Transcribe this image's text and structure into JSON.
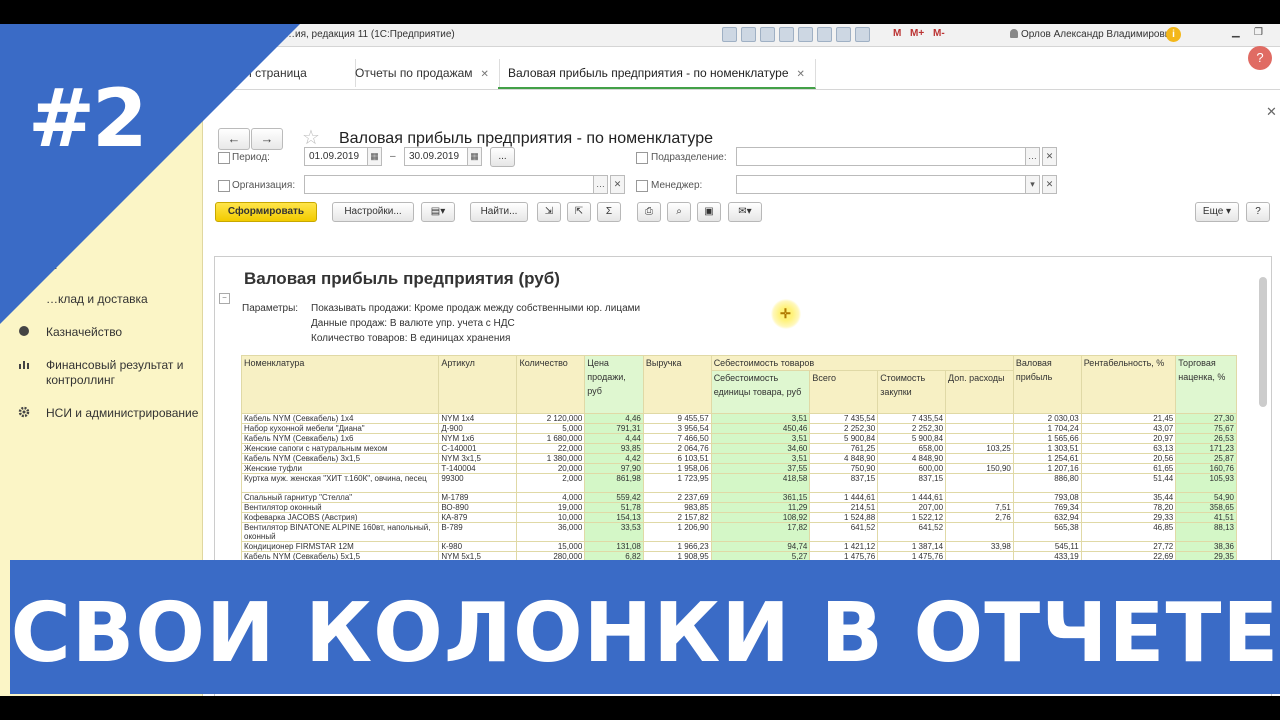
{
  "window": {
    "title": "…ия, редакция 11 (1С:Предприятие)",
    "user": "Орлов Александр Владимирович",
    "mm": [
      "M",
      "M+",
      "M-"
    ]
  },
  "tabs": [
    {
      "label": "…ная страница"
    },
    {
      "label": "Отчеты по продажам"
    },
    {
      "label": "Валовая прибыль предприятия - по номенклатуре"
    }
  ],
  "sidebar": {
    "items": [
      {
        "label": "…"
      },
      {
        "label": "…клад и доставка"
      },
      {
        "label": "Казначейство"
      },
      {
        "label": "Финансовый результат и контроллинг"
      },
      {
        "label": "НСИ и администрирование"
      }
    ]
  },
  "form": {
    "title": "Валовая прибыль предприятия - по номенклатуре",
    "period_label": "Период:",
    "date_from": "01.09.2019",
    "date_to": "30.09.2019",
    "dash": "–",
    "org_label": "Организация:",
    "dept_label": "Подразделение:",
    "manager_label": "Менеджер:",
    "buttons": {
      "generate": "Сформировать",
      "settings": "Настройки...",
      "find": "Найти...",
      "sum": "Σ",
      "more": "Еще ▾",
      "help": "?",
      "dots": "..."
    }
  },
  "report": {
    "title": "Валовая прибыль предприятия (руб)",
    "params_label": "Параметры:",
    "params": [
      "Показывать продажи: Кроме продаж между собственными юр. лицами",
      "Данные продаж: В валюте упр. учета с НДС",
      "Количество товаров: В единицах хранения"
    ],
    "headers": {
      "nomenclature": "Номенклатура",
      "article": "Артикул",
      "qty": "Количество",
      "price": "Цена продажи, руб",
      "revenue": "Выручка",
      "cost_group": "Себестоимость товаров",
      "unit_cost": "Себестоимость единицы товара, руб",
      "total": "Всего",
      "purchase_cost": "Стоимость закупки",
      "extra": "Доп. расходы",
      "gross": "Валовая прибыль",
      "profitability": "Рентабельность, %",
      "markup": "Торговая наценка, %"
    },
    "rows": [
      [
        "Кабель NYM (Севкабель) 1х4",
        "NYM 1x4",
        "2 120,000",
        "4,46",
        "9 455,57",
        "3,51",
        "7 435,54",
        "7 435,54",
        "",
        "2 030,03",
        "21,45",
        "27,30"
      ],
      [
        "Набор кухонной мебели \"Диана\"",
        "Д-900",
        "5,000",
        "791,31",
        "3 956,54",
        "450,46",
        "2 252,30",
        "2 252,30",
        "",
        "1 704,24",
        "43,07",
        "75,67"
      ],
      [
        "Кабель NYM (Севкабель) 1х6",
        "NYM 1x6",
        "1 680,000",
        "4,44",
        "7 466,50",
        "3,51",
        "5 900,84",
        "5 900,84",
        "",
        "1 565,66",
        "20,97",
        "26,53"
      ],
      [
        "Женские сапоги с натуральным мехом",
        "С-140001",
        "22,000",
        "93,85",
        "2 064,76",
        "34,60",
        "761,25",
        "658,00",
        "103,25",
        "1 303,51",
        "63,13",
        "171,23"
      ],
      [
        "Кабель NYM (Севкабель) 3х1,5",
        "NYM 3x1,5",
        "1 380,000",
        "4,42",
        "6 103,51",
        "3,51",
        "4 848,90",
        "4 848,90",
        "",
        "1 254,61",
        "20,56",
        "25,87"
      ],
      [
        "Женские туфли",
        "Т-140004",
        "20,000",
        "97,90",
        "1 958,06",
        "37,55",
        "750,90",
        "600,00",
        "150,90",
        "1 207,16",
        "61,65",
        "160,76"
      ],
      [
        "Куртка муж. женская \"ХИТ т.160К\", овчина, песец",
        "99300",
        "2,000",
        "861,98",
        "1 723,95",
        "418,58",
        "837,15",
        "837,15",
        "",
        "886,80",
        "51,44",
        "105,93"
      ],
      [
        "Спальный гарнитур \"Стелла\"",
        "М-1789",
        "4,000",
        "559,42",
        "2 237,69",
        "361,15",
        "1 444,61",
        "1 444,61",
        "",
        "793,08",
        "35,44",
        "54,90"
      ],
      [
        "Вентилятор оконный",
        "ВО-890",
        "19,000",
        "51,78",
        "983,85",
        "11,29",
        "214,51",
        "207,00",
        "7,51",
        "769,34",
        "78,20",
        "358,65"
      ],
      [
        "Кофеварка JACOBS (Австрия)",
        "КА-879",
        "10,000",
        "154,13",
        "2 157,82",
        "108,92",
        "1 524,88",
        "1 522,12",
        "2,76",
        "632,94",
        "29,33",
        "41,51"
      ],
      [
        "Вентилятор BINATONE ALPINE 160вт, напольный, оконный",
        "В-789",
        "36,000",
        "33,53",
        "1 206,90",
        "17,82",
        "641,52",
        "641,52",
        "",
        "565,38",
        "46,85",
        "88,13"
      ],
      [
        "Кондиционер FIRMSTAR 12М",
        "К-980",
        "15,000",
        "131,08",
        "1 966,23",
        "94,74",
        "1 421,12",
        "1 387,14",
        "33,98",
        "545,11",
        "27,72",
        "38,36"
      ],
      [
        "Кабель NYM (Севкабель) 5х1,5",
        "NYM 5x1,5",
        "280,000",
        "6,82",
        "1 908,95",
        "5,27",
        "1 475,76",
        "1 475,76",
        "",
        "433,19",
        "22,69",
        "29,35"
      ]
    ]
  },
  "overlay": {
    "badge": "#2",
    "caption": "СВОИ КОЛОНКИ В ОТЧЕТЕ",
    "help": "?"
  }
}
